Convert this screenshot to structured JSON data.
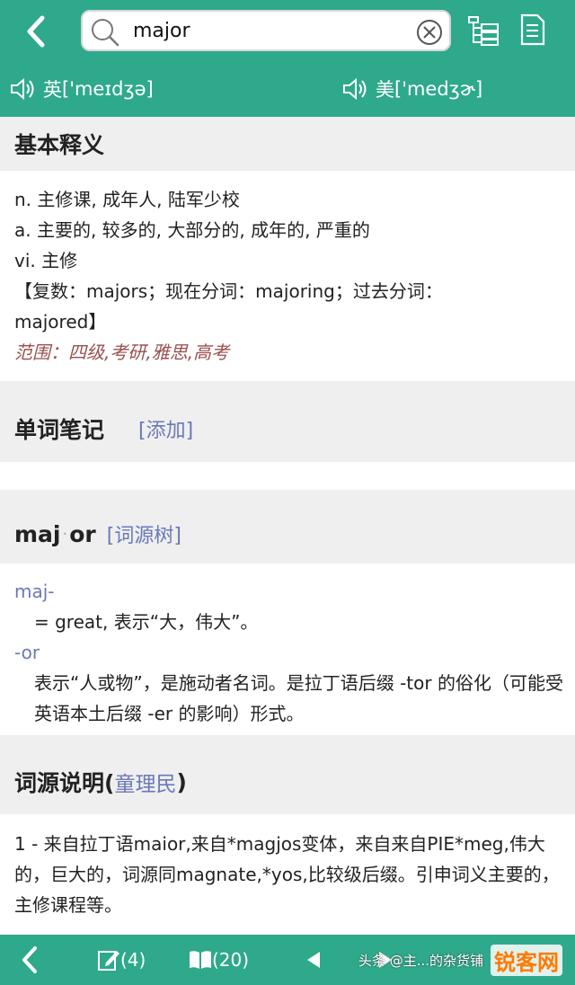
{
  "search": {
    "value": "major"
  },
  "pronunciation": {
    "uk_label": "英",
    "uk_ipa": "['meɪdʒə]",
    "us_label": "美",
    "us_ipa": "['medʒɚ]"
  },
  "basic": {
    "title": "基本释义",
    "lines": [
      "n. 主修课, 成年人, 陆军少校",
      "a. 主要的, 较多的, 大部分的, 成年的, 严重的",
      "vi. 主修",
      "【复数：majors；现在分词：majoring；过去分词：",
      "majored】"
    ],
    "range": "范围：四级,考研,雅思,高考"
  },
  "notes": {
    "title": "单词笔记",
    "add_link": "[添加]"
  },
  "root": {
    "word_part1": "maj",
    "word_dot": "·",
    "word_part2": "or",
    "tree_link": "[词源树]",
    "items": [
      {
        "key": "maj-",
        "desc": "= great, 表示“大，伟大”。"
      },
      {
        "key": "-or",
        "desc": "表示“人或物”，是施动者名词。是拉丁语后缀 -tor 的俗化（可能受英语本土后缀 -er 的影响）形式。"
      }
    ]
  },
  "etymology": {
    "title": "词源说明(",
    "author": "童理民",
    "title_end": ")",
    "text": "1 - 来自拉丁语maior,来自*magjos变体，来自来自PIE*meg,伟大的，巨大的，词源同magnate,*yos,比较级后缀。引申词义主要的，主修课程等。"
  },
  "bottom": {
    "notes_count": "(4)",
    "book_count": "(20)"
  },
  "watermark": {
    "text": "头条 @主...的杂货铺",
    "logo": "锐客网"
  },
  "colors": {
    "accent": "#2ea98c",
    "link": "#6b79b8",
    "range": "#9a4f4f"
  },
  "icons": [
    "back-icon",
    "search-icon",
    "clear-icon",
    "tree-icon",
    "note-list-icon",
    "speaker-icon",
    "edit-icon",
    "book-icon",
    "prev-icon",
    "next-icon"
  ]
}
